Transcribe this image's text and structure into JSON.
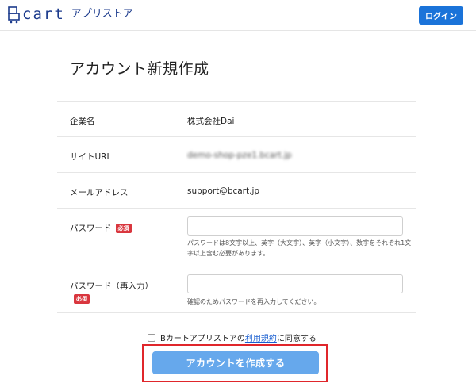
{
  "header": {
    "logo_text": "cart",
    "logo_sub": "アプリストア",
    "login_label": "ログイン"
  },
  "page_title": "アカウント新規作成",
  "form": {
    "company": {
      "label": "企業名",
      "value": "株式会社Dai"
    },
    "site_url": {
      "label": "サイトURL",
      "value": "demo-shop-pze1.bcart.jp"
    },
    "email": {
      "label": "メールアドレス",
      "value": "support@bcart.jp"
    },
    "password": {
      "label": "パスワード",
      "required_badge": "必須",
      "value": "",
      "help": "パスワードは8文字以上、英字（大文字）、英字（小文字）、数字をそれぞれ1文字以上含む必要があります。"
    },
    "password_confirm": {
      "label": "パスワード（再入力）",
      "required_badge": "必須",
      "value": "",
      "help": "確認のためパスワードを再入力してください。"
    }
  },
  "agreement": {
    "prefix": "Bカートアプリストアの",
    "link": "利用規約",
    "suffix": "に同意する",
    "checked": false
  },
  "submit_label": "アカウントを作成する",
  "colors": {
    "brand": "#1b3a8c",
    "primary": "#1a73d9",
    "submit": "#66a8ec",
    "required": "#d9363e",
    "highlight": "#e0262b"
  }
}
